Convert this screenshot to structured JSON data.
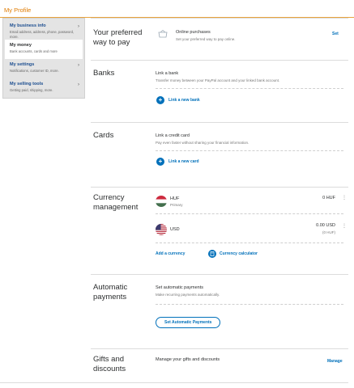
{
  "header": {
    "title": "My Profile"
  },
  "sidebar": {
    "items": [
      {
        "label": "My business info",
        "desc": "Email address, address, phone, password, more."
      },
      {
        "label": "My money",
        "desc": "Bank accounts, cards and more"
      },
      {
        "label": "My settings",
        "desc": "Notifications, customer ID, more."
      },
      {
        "label": "My selling tools",
        "desc": "Getting paid, shipping, more."
      }
    ]
  },
  "preferred": {
    "title": "Your preferred way to pay",
    "line1": "Online purchases",
    "line2": "Set your preferred way to pay online.",
    "action": "Set"
  },
  "banks": {
    "title": "Banks",
    "line1": "Link a bank",
    "line2": "Transfer money between your PayPal account and your linked bank account.",
    "add": "Link a new bank"
  },
  "cards": {
    "title": "Cards",
    "line1": "Link a credit card",
    "line2": "Pay even faster without sharing your financial information.",
    "add": "Link a new card"
  },
  "currency": {
    "title": "Currency management",
    "rows": [
      {
        "code": "HUF",
        "sub": "Primary",
        "amount": "0 HUF",
        "note": ""
      },
      {
        "code": "USD",
        "sub": "",
        "amount": "0.00 USD",
        "note": "(0 HUF)"
      }
    ],
    "add": "Add a currency",
    "calc": "Currency calculator"
  },
  "automatic": {
    "title": "Automatic payments",
    "line1": "Set automatic payments",
    "line2": "Make recurring payments automatically.",
    "button": "Set Automatic Payments"
  },
  "gifts": {
    "title": "Gifts and discounts",
    "line1": "Manage your gifts and discounts",
    "action": "Manage"
  },
  "colors": {
    "accent": "#0070ba",
    "header_orange": "#e07b00",
    "sidebar_bg": "#e4e4e4"
  },
  "icons": [
    "wallet-icon",
    "plus-icon",
    "hungary-flag-icon",
    "us-flag-icon",
    "kebab-icon",
    "calculator-icon",
    "chevron-right-icon"
  ]
}
